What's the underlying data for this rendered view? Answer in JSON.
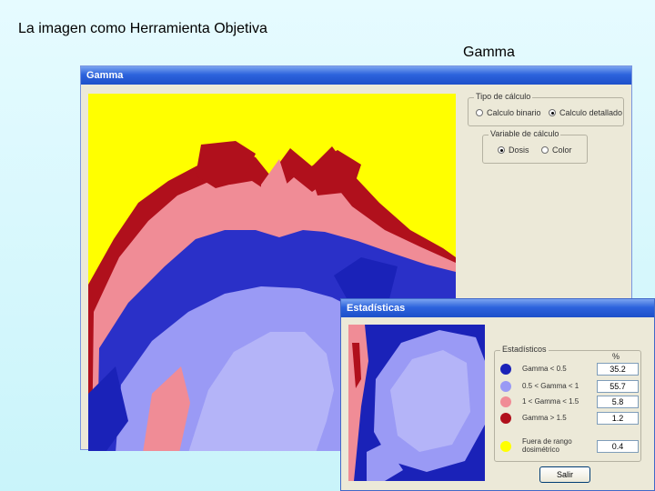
{
  "slide": {
    "title": "La imagen como Herramienta Objetiva",
    "subtitle": "Gamma"
  },
  "main_window": {
    "title": "Gamma",
    "tipo_calculo": {
      "legend": "Tipo de cálculo",
      "options": [
        {
          "label": "Calculo binario",
          "selected": false
        },
        {
          "label": "Calculo detallado",
          "selected": true
        }
      ]
    },
    "variable_calculo": {
      "legend": "Variable de cálculo",
      "options": [
        {
          "label": "Dosis",
          "selected": true
        },
        {
          "label": "Color",
          "selected": false
        }
      ]
    }
  },
  "stats_window": {
    "title": "Estadísticas",
    "legend": "Estadísticos",
    "percent_header": "%",
    "rows": [
      {
        "label": "Gamma < 0.5",
        "value": "35.2",
        "color": "#1a22b8"
      },
      {
        "label": "0.5 < Gamma < 1",
        "value": "55.7",
        "color": "#9a9af5"
      },
      {
        "label": "1 < Gamma < 1.5",
        "value": "5.8",
        "color": "#f08c96"
      },
      {
        "label": "Gamma > 1.5",
        "value": "1.2",
        "color": "#b0101c"
      },
      {
        "label": "Fuera de rango dosimétrico",
        "value": "0.4",
        "color": "#ffff00"
      }
    ],
    "button_label": "Salir"
  },
  "colors": {
    "yellow": "#ffff00",
    "dark_blue": "#1a22b8",
    "light_blue": "#9a9af5",
    "pink": "#f08c96",
    "dark_red": "#b0101c",
    "title_blue": "#2d63dd",
    "window_bg": "#ece9d8"
  }
}
